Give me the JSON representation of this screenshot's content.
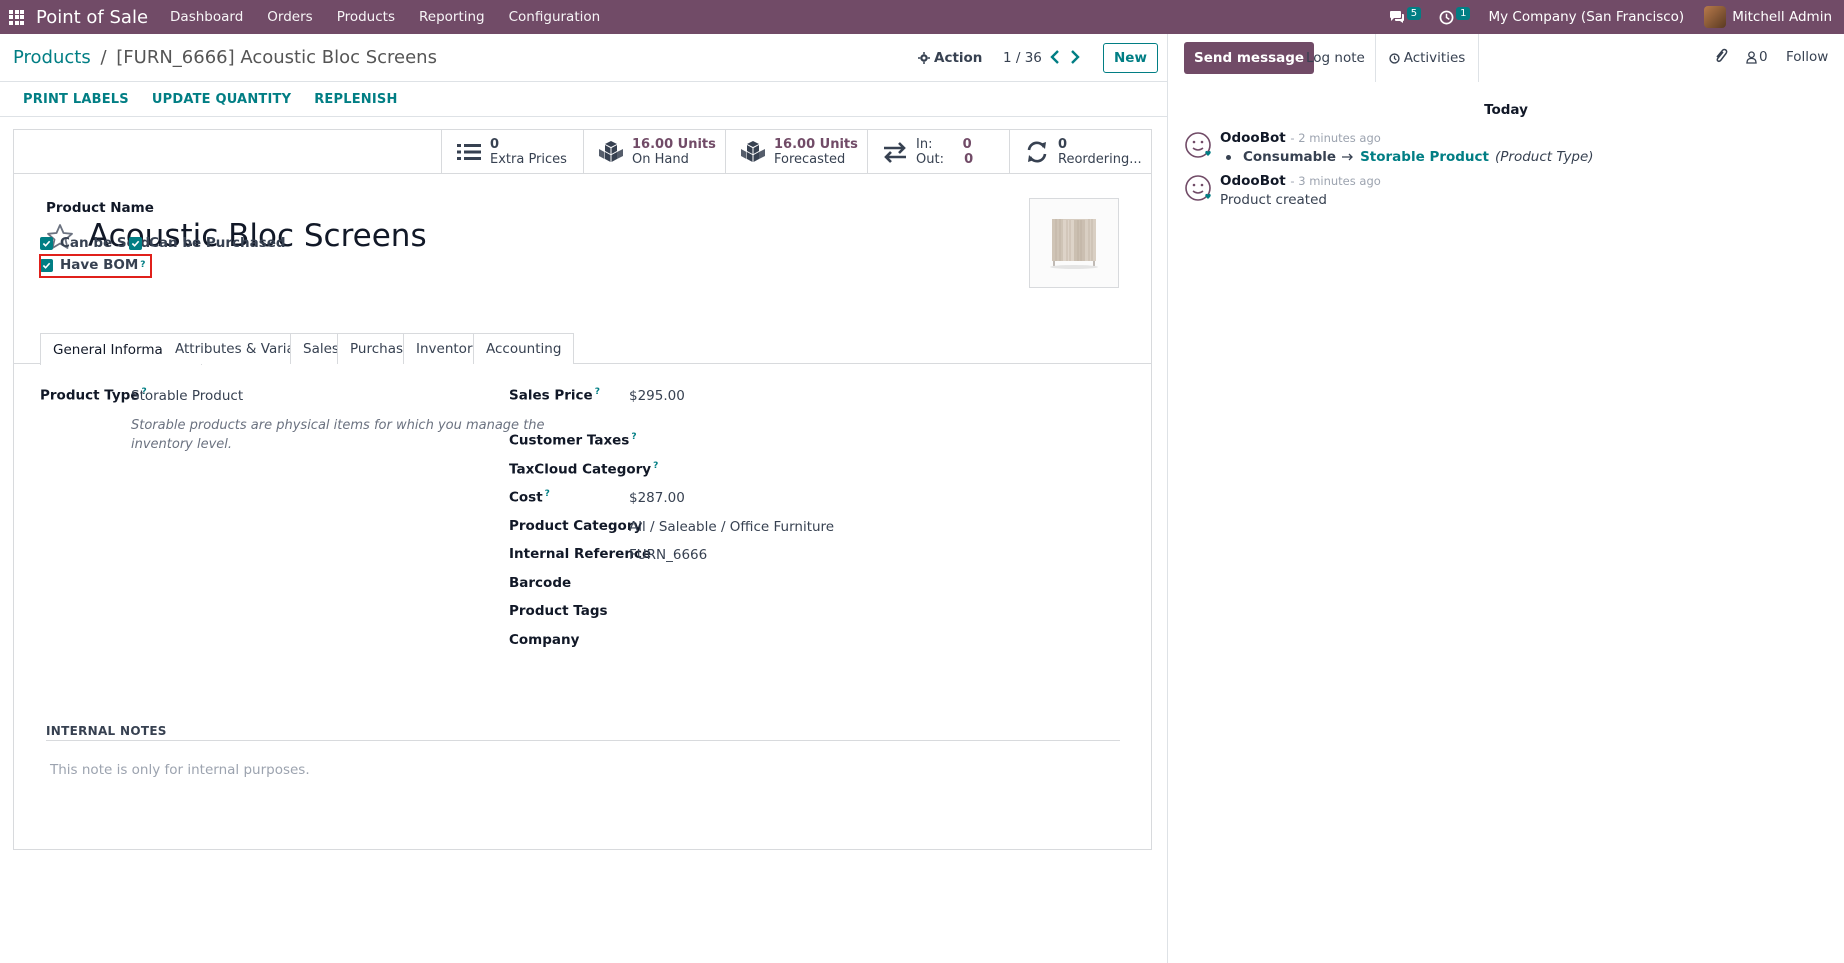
{
  "navbar": {
    "app_name": "Point of Sale",
    "menu": [
      "Dashboard",
      "Orders",
      "Products",
      "Reporting",
      "Configuration"
    ],
    "messages_count": "5",
    "activities_count": "1",
    "company": "My Company (San Francisco)",
    "user": "Mitchell Admin",
    "color": "#714b67"
  },
  "control": {
    "breadcrumb_parent": "Products",
    "breadcrumb_sep": "/",
    "breadcrumb_current": "[FURN_6666] Acoustic Bloc Screens",
    "action_label": "Action",
    "pager": "1 / 36",
    "new_label": "New"
  },
  "header_buttons": [
    "PRINT LABELS",
    "UPDATE QUANTITY",
    "REPLENISH"
  ],
  "smart_buttons": [
    {
      "value": "0",
      "label": "Extra Prices",
      "icon": "list-icon"
    },
    {
      "value": "16.00 Units",
      "label": "On Hand",
      "icon": "cubes-icon"
    },
    {
      "value": "16.00 Units",
      "label": "Forecasted",
      "icon": "cubes-icon"
    },
    {
      "in_label": "In:",
      "in_value": "0",
      "out_label": "Out:",
      "out_value": "0",
      "icon": "exchange-icon"
    },
    {
      "value": "0",
      "label": "Reordering...",
      "icon": "refresh-icon"
    }
  ],
  "form": {
    "product_name_label": "Product Name",
    "product_name": "Acoustic Bloc Screens",
    "can_be_sold": "Can be Sold",
    "can_be_purchased": "Can be Purchased",
    "have_bom": "Have BOM",
    "help_mark": "?",
    "tabs": [
      "General Information",
      "Attributes & Variants",
      "Sales",
      "Purchase",
      "Inventory",
      "Accounting"
    ],
    "product_type_label": "Product Type",
    "product_type": "Storable Product",
    "product_type_help": "Storable products are physical items for which you manage the inventory level.",
    "sales_price_label": "Sales Price",
    "sales_price": "$295.00",
    "customer_taxes_label": "Customer Taxes",
    "taxcloud_label": "TaxCloud Category",
    "cost_label": "Cost",
    "cost": "$287.00",
    "category_label": "Product Category",
    "category": "All / Saleable / Office Furniture",
    "internal_ref_label": "Internal Reference",
    "internal_ref": "FURN_6666",
    "barcode_label": "Barcode",
    "tags_label": "Product Tags",
    "company_label": "Company",
    "notes_title": "INTERNAL NOTES",
    "notes_placeholder": "This note is only for internal purposes."
  },
  "chatter": {
    "send_message": "Send message",
    "log_note": "Log note",
    "activities": "Activities",
    "followers_count": "0",
    "follow": "Follow",
    "today": "Today",
    "messages": [
      {
        "author": "OdooBot",
        "time": "- 2 minutes ago",
        "old_value": "Consumable",
        "new_value": "Storable Product",
        "field": "(Product Type)"
      },
      {
        "author": "OdooBot",
        "time": "- 3 minutes ago",
        "body": "Product created"
      }
    ]
  }
}
